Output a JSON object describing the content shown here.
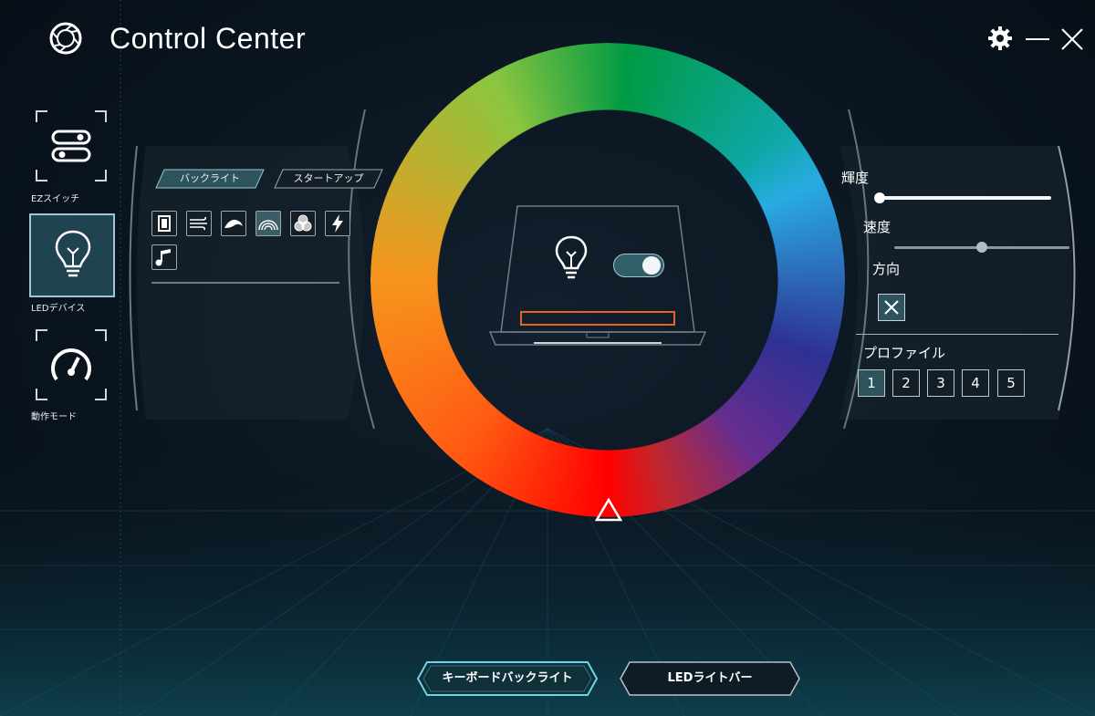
{
  "window": {
    "title": "Control Center"
  },
  "sidebar": {
    "items": [
      {
        "label": "EZスイッチ",
        "icon": "toggle-switches-icon"
      },
      {
        "label": "LEDデバイス",
        "icon": "lightbulb-icon"
      },
      {
        "label": "動作モード",
        "icon": "speedometer-icon"
      }
    ],
    "active_index": 1
  },
  "led_panel": {
    "tabs": [
      {
        "label": "バックライト",
        "active": true
      },
      {
        "label": "スタートアップ",
        "active": false
      }
    ],
    "effects": [
      {
        "name": "static-effect-icon"
      },
      {
        "name": "wind-effect-icon"
      },
      {
        "name": "wave-effect-icon"
      },
      {
        "name": "rainbow-effect-icon",
        "active": true
      },
      {
        "name": "color-mix-effect-icon"
      },
      {
        "name": "flash-effect-icon"
      },
      {
        "name": "music-effect-icon"
      }
    ]
  },
  "center": {
    "led_enabled": true
  },
  "settings": {
    "brightness_label": "輝度",
    "brightness_value": 0,
    "speed_label": "速度",
    "speed_value": 0.5,
    "direction_label": "方向",
    "profile_label": "プロファイル",
    "profiles": [
      "1",
      "2",
      "3",
      "4",
      "5"
    ],
    "active_profile": "1"
  },
  "bottom": {
    "keyboard_backlight": "キーボードバックライト",
    "led_light_bar": "LEDライトバー"
  },
  "colors": {
    "accent": "#2d535c",
    "background": "#0a1520",
    "active_glow": "#6fd3e6"
  }
}
